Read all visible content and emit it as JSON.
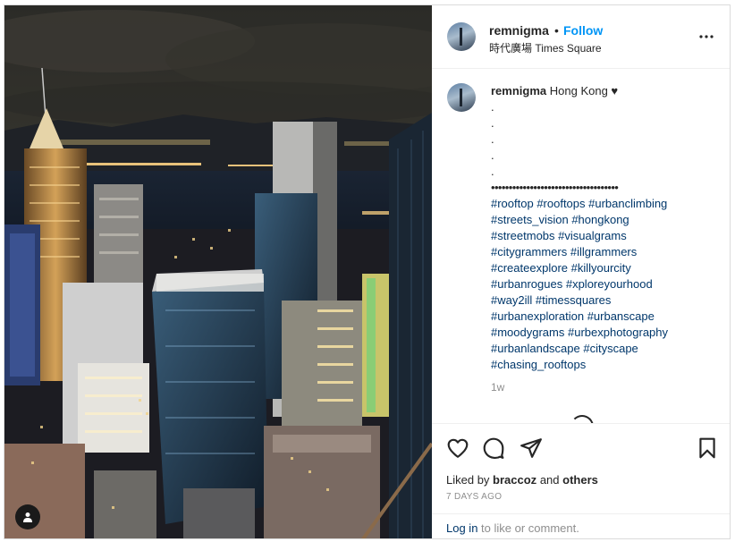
{
  "post": {
    "username": "remnigma",
    "separator": "•",
    "follow_label": "Follow",
    "location": "時代廣場 Times Square",
    "more_icon": "more-horizontal-icon"
  },
  "caption": {
    "username": "remnigma",
    "title": "Hong Kong ♥",
    "dots": [
      ".",
      ".",
      ".",
      ".",
      "."
    ],
    "divider": "••••••••••••••••••••••••••••••••••••",
    "hashtag_lines": [
      "#rooftop #rooftops #urbanclimbing",
      "#streets_vision #hongkong",
      "#streetmobs #visualgrams",
      "#citygrammers #illgrammers",
      "#createexplore #killyourcity",
      "#urbanrogues #xploreyourhood",
      "#way2ill #timessquares",
      "#urbanexploration #urbanscape",
      "#moodygrams #urbexphotography",
      "#urbanlandscape #cityscape",
      "#chasing_rooftops"
    ],
    "time": "1w"
  },
  "actions": {
    "icons": [
      "heart-icon",
      "comment-icon",
      "share-icon",
      "bookmark-icon"
    ],
    "liked_by_prefix": "Liked by",
    "liked_by_user": "braccoz",
    "liked_by_and": "and",
    "liked_by_others": "others",
    "posted_ago": "7 DAYS AGO",
    "login_link": "Log in",
    "login_suffix": "to like or comment."
  },
  "photo": {
    "tag_icon": "user-tag-icon"
  },
  "colors": {
    "link_blue": "#0095f6",
    "hashtag": "#00376b",
    "muted": "#8e8e8e"
  }
}
